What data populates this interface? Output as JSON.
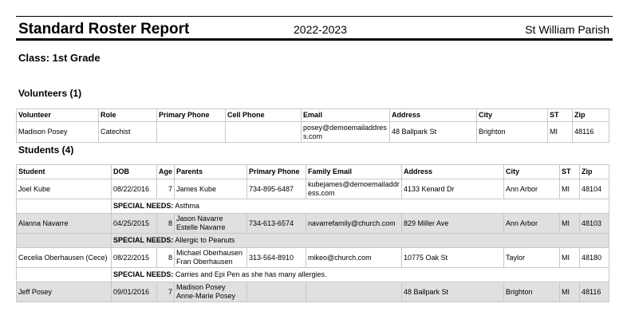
{
  "report": {
    "title": "Standard Roster Report",
    "year": "2022-2023",
    "parish": "St William Parish"
  },
  "class_label": "Class: 1st Grade",
  "volunteers": {
    "heading": "Volunteers (1)",
    "columns": [
      "Volunteer",
      "Role",
      "Primary Phone",
      "Cell Phone",
      "Email",
      "Address",
      "City",
      "ST",
      "Zip"
    ],
    "rows": [
      {
        "name": "Madison Posey",
        "role": "Catechist",
        "primary_phone": "",
        "cell_phone": "",
        "email": "posey@demoemailaddress.com",
        "address": "48 Ballpark St",
        "city": "Brighton",
        "st": "MI",
        "zip": "48116"
      }
    ]
  },
  "students": {
    "heading": "Students (4)",
    "columns": [
      "Student",
      "DOB",
      "Age",
      "Parents",
      "Primary Phone",
      "Family Email",
      "Address",
      "City",
      "ST",
      "Zip"
    ],
    "special_needs_label": "SPECIAL NEEDS:",
    "rows": [
      {
        "name": "Joel Kube",
        "dob": "08/22/2016",
        "age": "7",
        "parent1": "James Kube",
        "parent2": "",
        "phone": "734-895-6487",
        "email": "kubejames@demoemailaddress.com",
        "address": "4133 Kenard Dr",
        "city": "Ann Arbor",
        "st": "MI",
        "zip": "48104",
        "special_needs": "Asthma"
      },
      {
        "name": "Alanna Navarre",
        "dob": "04/25/2015",
        "age": "8",
        "parent1": "Jason Navarre",
        "parent2": "Estelle Navarre",
        "phone": "734-613-6574",
        "email": "navarrefamily@church.com",
        "address": "829 Miller Ave",
        "city": "Ann Arbor",
        "st": "MI",
        "zip": "48103",
        "special_needs": "Allergic to Peanuts"
      },
      {
        "name": "Cecelia Oberhausen (Cece)",
        "dob": "08/22/2015",
        "age": "8",
        "parent1": "Michael Oberhausen",
        "parent2": "Fran Oberhausen",
        "phone": "313-564-8910",
        "email": "mikeo@church.com",
        "address": "10775 Oak St",
        "city": "Taylor",
        "st": "MI",
        "zip": "48180",
        "special_needs": "Carries and Epi Pen as she has many allergies."
      },
      {
        "name": "Jeff Posey",
        "dob": "09/01/2016",
        "age": "7",
        "parent1": "Madison Posey",
        "parent2": "Anne-Marie Posey",
        "phone": "",
        "email": "",
        "address": "48 Ballpark St",
        "city": "Brighton",
        "st": "MI",
        "zip": "48116"
      }
    ]
  }
}
